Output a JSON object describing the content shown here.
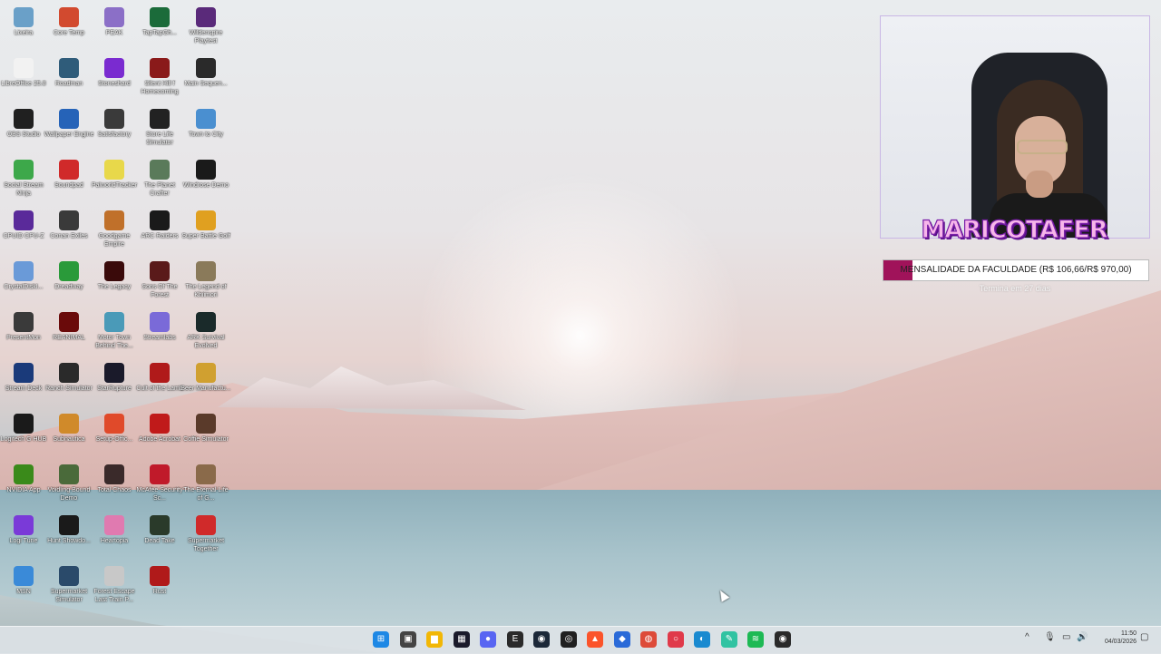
{
  "goal": {
    "label": "MENSALIDADE DA FACULDADE (R$ 106,66/R$ 970,00)",
    "progress_percent": 11,
    "fill_color": "#a0135a",
    "ends_text": "Termina em 27 dias"
  },
  "webcam": {
    "brand": "MARICOTAFER"
  },
  "desktop_icons": [
    {
      "label": "Lixeira",
      "icon": "recycle-bin-icon",
      "color": "#6aa0c8"
    },
    {
      "label": "Core Temp",
      "icon": "core-temp-icon",
      "color": "#d24a2f"
    },
    {
      "label": "PEAK",
      "icon": "peak-icon",
      "color": "#8b6fc7"
    },
    {
      "label": "TapTapGh...",
      "icon": "taptap-icon",
      "color": "#1b6b3a"
    },
    {
      "label": "Wildenspire Playtest",
      "icon": "wildenspire-icon",
      "color": "#5a2a7a"
    },
    {
      "label": "LibreOffice 25.8",
      "icon": "libreoffice-icon",
      "color": "#f2f2f2"
    },
    {
      "label": "Roadman",
      "icon": "roadman-icon",
      "color": "#2f5c7a"
    },
    {
      "label": "Stoneshard",
      "icon": "stoneshard-icon",
      "color": "#7a2bd0"
    },
    {
      "label": "Silent Hill f Homecoming",
      "icon": "silent-hill-icon",
      "color": "#8a1a1a"
    },
    {
      "label": "Main Sequen...",
      "icon": "main-sequence-icon",
      "color": "#2a2a2a"
    },
    {
      "label": "OBS Studio",
      "icon": "obs-icon",
      "color": "#202020"
    },
    {
      "label": "Wallpaper Engine",
      "icon": "wallpaper-engine-icon",
      "color": "#2663b8"
    },
    {
      "label": "Satisfactory",
      "icon": "satisfactory-icon",
      "color": "#3a3a3a"
    },
    {
      "label": "Store Life Simulator",
      "icon": "store-life-icon",
      "color": "#222222"
    },
    {
      "label": "Town to City",
      "icon": "town-to-city-icon",
      "color": "#4a8fd0"
    },
    {
      "label": "Social Stream Ninja",
      "icon": "social-stream-icon",
      "color": "#3da84a"
    },
    {
      "label": "Soundpad",
      "icon": "soundpad-icon",
      "color": "#d02a2a"
    },
    {
      "label": "PalworldTracker",
      "icon": "palworld-icon",
      "color": "#e8d84a"
    },
    {
      "label": "The Planet Crafter",
      "icon": "planet-crafter-icon",
      "color": "#5a7a5a"
    },
    {
      "label": "Windrose Demo",
      "icon": "windrose-icon",
      "color": "#1a1a1a"
    },
    {
      "label": "CPUID CPU-Z",
      "icon": "cpuz-icon",
      "color": "#5a2a9a"
    },
    {
      "label": "Conan Exiles",
      "icon": "conan-icon",
      "color": "#3a3a3a"
    },
    {
      "label": "Goodgame Empire",
      "icon": "goodgame-icon",
      "color": "#c0702a"
    },
    {
      "label": "ARC Raiders",
      "icon": "arc-raiders-icon",
      "color": "#1a1a1a"
    },
    {
      "label": "Super Battle Golf",
      "icon": "super-battle-golf-icon",
      "color": "#e0a020"
    },
    {
      "label": "CrystalDiskI...",
      "icon": "crystaldisk-icon",
      "color": "#6a9ad8"
    },
    {
      "label": "Dreadway",
      "icon": "dreadway-icon",
      "color": "#2a9a3a"
    },
    {
      "label": "The Legacy",
      "icon": "the-legacy-icon",
      "color": "#3a0a0a"
    },
    {
      "label": "Sons Of The Forest",
      "icon": "sons-of-the-forest-icon",
      "color": "#5a1a1a"
    },
    {
      "label": "The Legend of Khiimori",
      "icon": "khiimori-icon",
      "color": "#8a7a5a"
    },
    {
      "label": "PresentMon",
      "icon": "presentmon-icon",
      "color": "#3a3a3a"
    },
    {
      "label": "REANIMAL",
      "icon": "reanimal-icon",
      "color": "#6a0a0a"
    },
    {
      "label": "Motor Town Behind The...",
      "icon": "motor-town-icon",
      "color": "#4a9ab8"
    },
    {
      "label": "Streamlabs",
      "icon": "streamlabs-icon",
      "color": "#7a6ad8"
    },
    {
      "label": "ARK Survival Evolved",
      "icon": "ark-icon",
      "color": "#1a2a2a"
    },
    {
      "label": "Stream Deck",
      "icon": "stream-deck-icon",
      "color": "#1a3a7a"
    },
    {
      "label": "Ranch Simulator",
      "icon": "ranch-simulator-icon",
      "color": "#2a2a2a"
    },
    {
      "label": "StarRupture",
      "icon": "starrupture-icon",
      "color": "#1a1a2a"
    },
    {
      "label": "Cult of the Lamb",
      "icon": "cult-of-the-lamb-icon",
      "color": "#b01a1a"
    },
    {
      "label": "Beer Manufactu...",
      "icon": "beer-manufacture-icon",
      "color": "#d0a030"
    },
    {
      "label": "Logitech G HUB",
      "icon": "logitech-ghub-icon",
      "color": "#1a1a1a"
    },
    {
      "label": "Subnautica",
      "icon": "subnautica-icon",
      "color": "#d08a2a"
    },
    {
      "label": "Setup-Offic...",
      "icon": "office-setup-icon",
      "color": "#e04a2a"
    },
    {
      "label": "Adobe Acrobat",
      "icon": "acrobat-icon",
      "color": "#c01a1a"
    },
    {
      "label": "Coffie Simulator",
      "icon": "coffee-simulator-icon",
      "color": "#5a3a2a"
    },
    {
      "label": "NVIDIA App",
      "icon": "nvidia-icon",
      "color": "#3a8a1a"
    },
    {
      "label": "Voidling Bound Demo",
      "icon": "voidling-icon",
      "color": "#4a6a3a"
    },
    {
      "label": "Total Chaos",
      "icon": "total-chaos-icon",
      "color": "#3a2a2a"
    },
    {
      "label": "McAfee Security Sc...",
      "icon": "mcafee-icon",
      "color": "#c01a2a"
    },
    {
      "label": "The Eternal Life of G...",
      "icon": "eternal-life-icon",
      "color": "#8a6a4a"
    },
    {
      "label": "Logi Tune",
      "icon": "logi-tune-icon",
      "color": "#7a3ad8"
    },
    {
      "label": "Hunt Showdo...",
      "icon": "hunt-showdown-icon",
      "color": "#1a1a1a"
    },
    {
      "label": "Heartopia",
      "icon": "heartopia-icon",
      "color": "#e07ab0"
    },
    {
      "label": "Dead Take",
      "icon": "dead-take-icon",
      "color": "#2a3a2a"
    },
    {
      "label": "Supermarket Together",
      "icon": "supermarket-together-icon",
      "color": "#d02a2a"
    },
    {
      "label": "MSN",
      "icon": "msn-icon",
      "color": "#3a8ad8"
    },
    {
      "label": "Supermarket Simulator",
      "icon": "supermarket-simulator-icon",
      "color": "#2a4a6a"
    },
    {
      "label": "Forest Escape Last Train P...",
      "icon": "forest-escape-icon",
      "color": "#c8c8c8"
    },
    {
      "label": "Rust",
      "icon": "rust-icon",
      "color": "#b01a1a"
    }
  ],
  "taskbar": {
    "apps": [
      {
        "icon": "windows-start-icon",
        "color": "#1e88e5",
        "glyph": "⊞"
      },
      {
        "icon": "task-view-icon",
        "color": "#444444",
        "glyph": "▣"
      },
      {
        "icon": "file-explorer-icon",
        "color": "#f2b705",
        "glyph": "▆"
      },
      {
        "icon": "stream-deck-taskbar-icon",
        "color": "#1a1a2a",
        "glyph": "▦"
      },
      {
        "icon": "discord-icon",
        "color": "#5865f2",
        "glyph": "●"
      },
      {
        "icon": "epic-games-icon",
        "color": "#2a2a2a",
        "glyph": "E"
      },
      {
        "icon": "steam-icon",
        "color": "#1b2838",
        "glyph": "◉"
      },
      {
        "icon": "obs-taskbar-icon",
        "color": "#202020",
        "glyph": "◎"
      },
      {
        "icon": "brave-icon",
        "color": "#fb542b",
        "glyph": "▲"
      },
      {
        "icon": "ea-app-icon",
        "color": "#2a6ad8",
        "glyph": "◆"
      },
      {
        "icon": "chrome-icon",
        "color": "#dd4b39",
        "glyph": "◍"
      },
      {
        "icon": "mcafee-taskbar-icon",
        "color": "#e03a4a",
        "glyph": "○"
      },
      {
        "icon": "edge-icon",
        "color": "#1a8ad0",
        "glyph": "◐"
      },
      {
        "icon": "streamlabs-taskbar-icon",
        "color": "#31c3a2",
        "glyph": "✎"
      },
      {
        "icon": "spotify-icon",
        "color": "#1db954",
        "glyph": "≋"
      },
      {
        "icon": "obs-studio-taskbar-icon",
        "color": "#2a2a2a",
        "glyph": "◉"
      }
    ],
    "clock_time": "11:50",
    "clock_date": "04/03/2026"
  }
}
